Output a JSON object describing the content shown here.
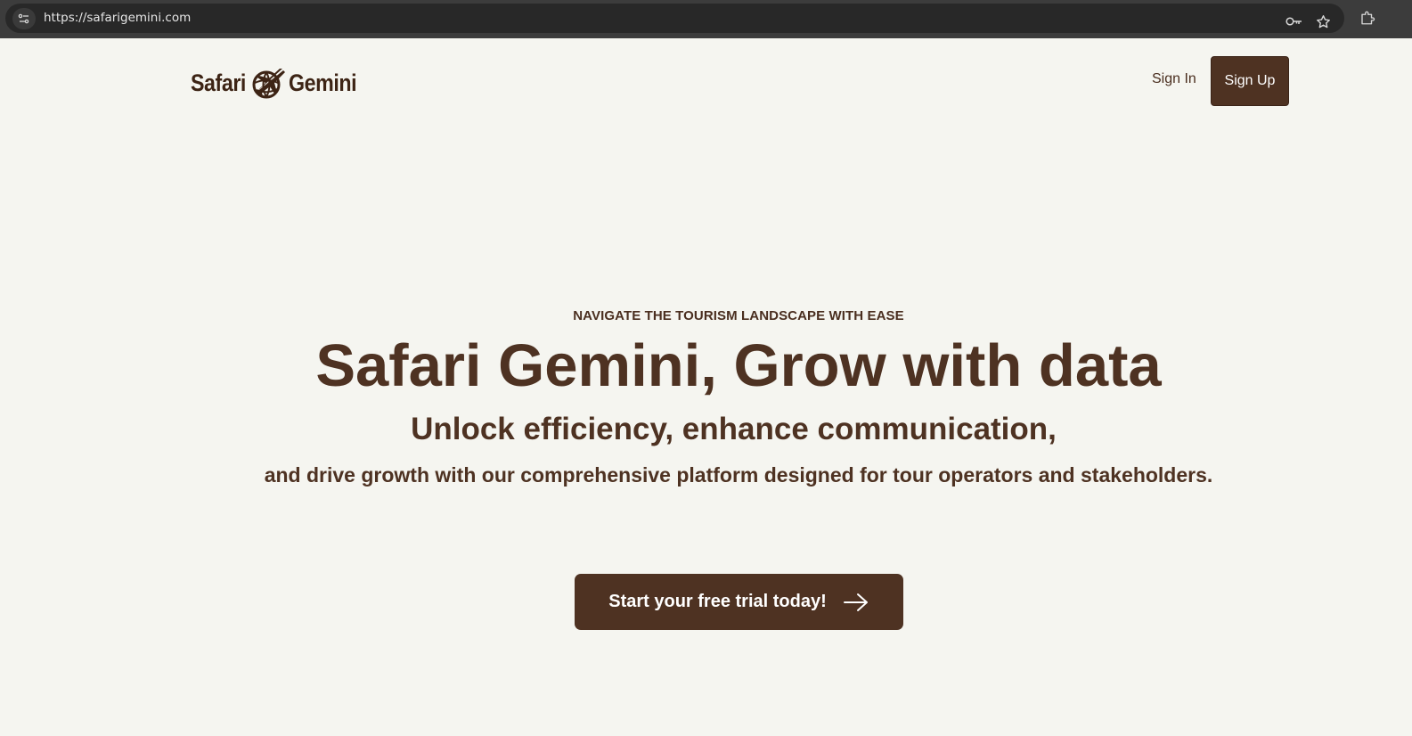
{
  "browser": {
    "url": "https://safarigemini.com",
    "icons": [
      "site-info-icon",
      "key-icon",
      "star-icon",
      "extensions-icon"
    ]
  },
  "header": {
    "logo_left": "Safari",
    "logo_right": "Gemini",
    "sign_in_label": "Sign In",
    "sign_up_label": "Sign Up"
  },
  "hero": {
    "eyebrow": "NAVIGATE THE TOURISM LANDSCAPE WITH EASE",
    "headline": "Safari Gemini, Grow with data",
    "subhead": "Unlock efficiency, enhance communication,",
    "subtext": "and drive growth with our comprehensive platform designed for tour operators and stakeholders.",
    "cta_label": "Start your free trial today!"
  },
  "colors": {
    "page_bg": "#f5f5f0",
    "brand_brown": "#4e3222",
    "text_dark": "#4a2e1f"
  }
}
